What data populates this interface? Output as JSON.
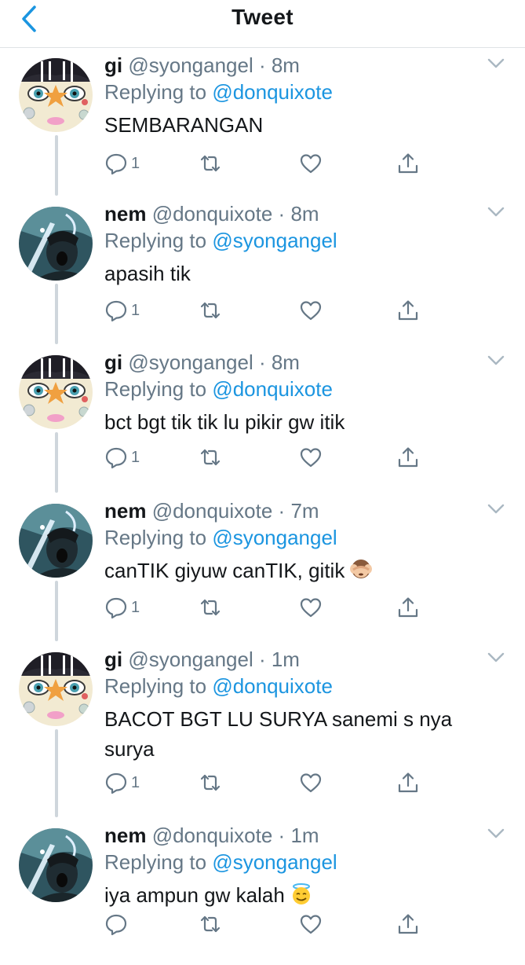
{
  "header": {
    "title": "Tweet"
  },
  "tweets": [
    {
      "name": "gi",
      "handle": "@syongangel",
      "time": "8m",
      "replying_prefix": "Replying to",
      "replying_to": "@donquixote",
      "text": "SEMBARANGAN",
      "reply_count": "1",
      "emoji": ""
    },
    {
      "name": "nem",
      "handle": "@donquixote",
      "time": "8m",
      "replying_prefix": "Replying to",
      "replying_to": "@syongangel",
      "text": "apasih tik",
      "reply_count": "1",
      "emoji": ""
    },
    {
      "name": "gi",
      "handle": "@syongangel",
      "time": "8m",
      "replying_prefix": "Replying to",
      "replying_to": "@donquixote",
      "text": "bct bgt tik tik lu pikir gw itik",
      "reply_count": "1",
      "emoji": ""
    },
    {
      "name": "nem",
      "handle": "@donquixote",
      "time": "7m",
      "replying_prefix": "Replying to",
      "replying_to": "@syongangel",
      "text": "canTIK giyuw canTIK, gitik",
      "reply_count": "1",
      "emoji": "see-no-evil-monkey"
    },
    {
      "name": "gi",
      "handle": "@syongangel",
      "time": "1m",
      "replying_prefix": "Replying to",
      "replying_to": "@donquixote",
      "text": "BACOT BGT LU SURYA sanemi s nya surya",
      "reply_count": "1",
      "emoji": ""
    },
    {
      "name": "nem",
      "handle": "@donquixote",
      "time": "1m",
      "replying_prefix": "Replying to",
      "replying_to": "@syongangel",
      "text": "iya ampun gw kalah",
      "reply_count": "",
      "emoji": "smiling-face-with-halo"
    }
  ],
  "colors": {
    "link": "#1b95e0",
    "muted": "#657786",
    "text": "#14171a",
    "thread_line": "#cfd6dc"
  }
}
